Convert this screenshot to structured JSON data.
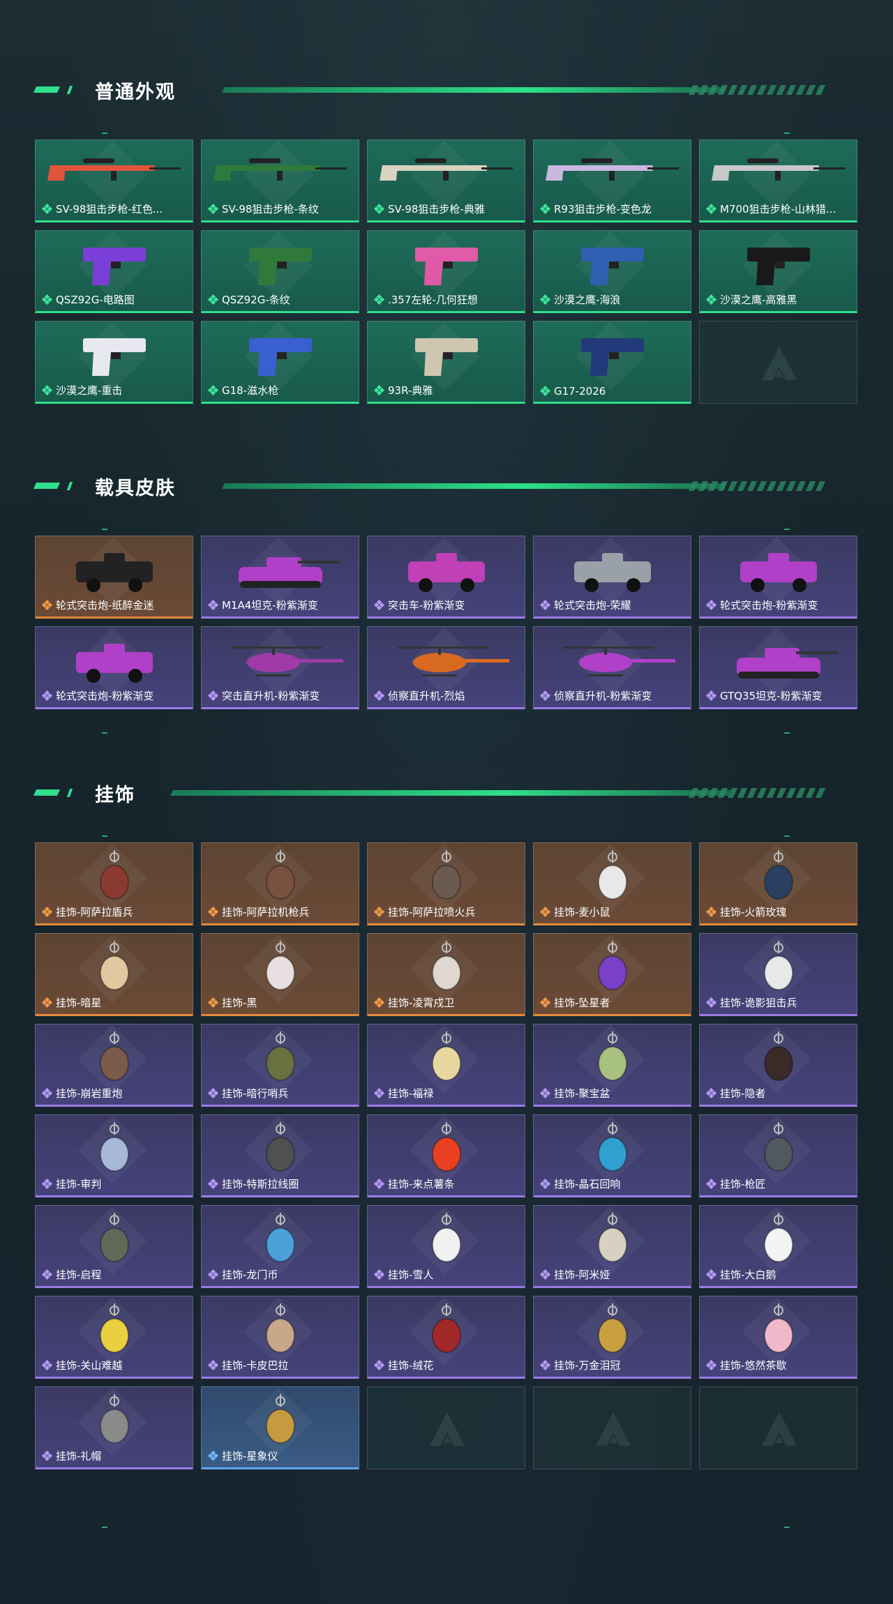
{
  "sections": {
    "weapons": {
      "title": "普通外观",
      "items": [
        {
          "label": "SV-98狙击步枪-红色...",
          "rarity": "green",
          "icon": "sniper-rifle-icon",
          "color": "#e0553b"
        },
        {
          "label": "SV-98狙击步枪-条纹",
          "rarity": "green",
          "icon": "sniper-rifle-icon",
          "color": "#2f7a3a"
        },
        {
          "label": "SV-98狙击步枪-典雅",
          "rarity": "green",
          "icon": "sniper-rifle-icon",
          "color": "#d8d2c0"
        },
        {
          "label": "R93狙击步枪-变色龙",
          "rarity": "green",
          "icon": "sniper-rifle-icon",
          "color": "#c9b8e0"
        },
        {
          "label": "M700狙击步枪-山林猎...",
          "rarity": "green",
          "icon": "sniper-rifle-icon",
          "color": "#c8c8c8"
        },
        {
          "label": "QSZ92G-电路图",
          "rarity": "green",
          "icon": "pistol-icon",
          "color": "#7a3fd6"
        },
        {
          "label": "QSZ92G-条纹",
          "rarity": "green",
          "icon": "pistol-icon",
          "color": "#2f7a3a"
        },
        {
          "label": ".357左轮-几何狂想",
          "rarity": "green",
          "icon": "revolver-icon",
          "color": "#e05aa8"
        },
        {
          "label": "沙漠之鹰-海浪",
          "rarity": "green",
          "icon": "pistol-icon",
          "color": "#2f5fb0"
        },
        {
          "label": "沙漠之鹰-高雅黑",
          "rarity": "green",
          "icon": "pistol-icon",
          "color": "#1a1a1a"
        },
        {
          "label": "沙漠之鹰-重击",
          "rarity": "green",
          "icon": "pistol-icon",
          "color": "#e8e8f0"
        },
        {
          "label": "G18-滋水枪",
          "rarity": "green",
          "icon": "pistol-icon",
          "color": "#3a5fd0"
        },
        {
          "label": "93R-典雅",
          "rarity": "green",
          "icon": "pistol-icon",
          "color": "#cfc6b0"
        },
        {
          "label": "G17-2026",
          "rarity": "green",
          "icon": "pistol-icon",
          "color": "#223a7a"
        },
        {
          "label": "",
          "rarity": "empty",
          "icon": "empty-slot-logo-icon",
          "color": ""
        }
      ]
    },
    "vehicles": {
      "title": "载具皮肤",
      "items": [
        {
          "label": "轮式突击炮-纸醉金迷",
          "rarity": "orange",
          "icon": "armored-car-icon",
          "color": "#222222"
        },
        {
          "label": "M1A4坦克-粉紫渐变",
          "rarity": "purple",
          "icon": "tank-icon",
          "color": "#b040c8"
        },
        {
          "label": "突击车-粉紫渐变",
          "rarity": "purple",
          "icon": "assault-vehicle-icon",
          "color": "#c040b8"
        },
        {
          "label": "轮式突击炮-荣耀",
          "rarity": "purple",
          "icon": "armored-car-icon",
          "color": "#9aa0a8"
        },
        {
          "label": "轮式突击炮-粉紫渐变",
          "rarity": "purple",
          "icon": "armored-car-icon",
          "color": "#b040c8"
        },
        {
          "label": "轮式突击炮-粉紫渐变",
          "rarity": "purple",
          "icon": "armored-car-icon",
          "color": "#b040c8"
        },
        {
          "label": "突击直升机-粉紫渐变",
          "rarity": "purple",
          "icon": "attack-helicopter-icon",
          "color": "#a03aa8"
        },
        {
          "label": "侦察直升机-烈焰",
          "rarity": "purple",
          "icon": "scout-helicopter-icon",
          "color": "#d86a20"
        },
        {
          "label": "侦察直升机-粉紫渐变",
          "rarity": "purple",
          "icon": "scout-helicopter-icon",
          "color": "#b040c8"
        },
        {
          "label": "GTQ35坦克-粉紫渐变",
          "rarity": "purple",
          "icon": "tank-icon",
          "color": "#b040c8"
        }
      ]
    },
    "charms": {
      "title": "挂饰",
      "items": [
        {
          "label": "挂饰-阿萨拉盾兵",
          "rarity": "orange",
          "icon": "charm-figure-icon",
          "color": "#8a3a30"
        },
        {
          "label": "挂饰-阿萨拉机枪兵",
          "rarity": "orange",
          "icon": "charm-figure-icon",
          "color": "#7a5040"
        },
        {
          "label": "挂饰-阿萨拉喷火兵",
          "rarity": "orange",
          "icon": "charm-figure-icon",
          "color": "#6a5a50"
        },
        {
          "label": "挂饰-麦小鼠",
          "rarity": "orange",
          "icon": "charm-mouse-icon",
          "color": "#e8e8e8"
        },
        {
          "label": "挂饰-火箭玫瑰",
          "rarity": "orange",
          "icon": "charm-rocket-icon",
          "color": "#2a4060"
        },
        {
          "label": "挂饰-暗星",
          "rarity": "orange",
          "icon": "charm-feather-icon",
          "color": "#e0c8a0"
        },
        {
          "label": "挂饰-黑",
          "rarity": "orange",
          "icon": "charm-tag-icon",
          "color": "#e8e0e0"
        },
        {
          "label": "挂饰-凌霄戍卫",
          "rarity": "orange",
          "icon": "charm-figure-icon",
          "color": "#e0d8d0"
        },
        {
          "label": "挂饰-坠星者",
          "rarity": "orange",
          "icon": "charm-crystal-icon",
          "color": "#7a40c8"
        },
        {
          "label": "挂饰-诡影狙击兵",
          "rarity": "purple",
          "icon": "charm-skull-icon",
          "color": "#e8e8e8"
        },
        {
          "label": "挂饰-崩岩重炮",
          "rarity": "purple",
          "icon": "charm-figure-icon",
          "color": "#7a5a48"
        },
        {
          "label": "挂饰-暗行哨兵",
          "rarity": "purple",
          "icon": "charm-figure-icon",
          "color": "#6a7040"
        },
        {
          "label": "挂饰-福禄",
          "rarity": "purple",
          "icon": "charm-figure-icon",
          "color": "#e8d8a0"
        },
        {
          "label": "挂饰-聚宝盆",
          "rarity": "purple",
          "icon": "charm-bowl-icon",
          "color": "#a8c080"
        },
        {
          "label": "挂饰-隐者",
          "rarity": "purple",
          "icon": "charm-card-icon",
          "color": "#3a2a28"
        },
        {
          "label": "挂饰-审判",
          "rarity": "purple",
          "icon": "charm-card-icon",
          "color": "#a8b8d8"
        },
        {
          "label": "挂饰-特斯拉线圈",
          "rarity": "purple",
          "icon": "charm-coil-icon",
          "color": "#505050"
        },
        {
          "label": "挂饰-来点薯条",
          "rarity": "purple",
          "icon": "charm-fries-icon",
          "color": "#e84020"
        },
        {
          "label": "挂饰-晶石回响",
          "rarity": "purple",
          "icon": "charm-gem-icon",
          "color": "#30a0d0"
        },
        {
          "label": "挂饰-枪匠",
          "rarity": "purple",
          "icon": "charm-box-icon",
          "color": "#505860"
        },
        {
          "label": "挂饰-启程",
          "rarity": "purple",
          "icon": "charm-compass-icon",
          "color": "#606858"
        },
        {
          "label": "挂饰-龙门币",
          "rarity": "purple",
          "icon": "charm-tag-icon",
          "color": "#4aa0d8"
        },
        {
          "label": "挂饰-雪人",
          "rarity": "purple",
          "icon": "charm-snowman-icon",
          "color": "#f0f0f0"
        },
        {
          "label": "挂饰-阿米娅",
          "rarity": "purple",
          "icon": "charm-figure-icon",
          "color": "#d8d0c0"
        },
        {
          "label": "挂饰-大白鹅",
          "rarity": "purple",
          "icon": "charm-goose-icon",
          "color": "#f4f4f4"
        },
        {
          "label": "挂饰-关山难越",
          "rarity": "purple",
          "icon": "charm-cylinder-icon",
          "color": "#e8d040"
        },
        {
          "label": "挂饰-卡皮巴拉",
          "rarity": "purple",
          "icon": "charm-capybara-icon",
          "color": "#c8a888"
        },
        {
          "label": "挂饰-绒花",
          "rarity": "purple",
          "icon": "charm-flower-icon",
          "color": "#a02828"
        },
        {
          "label": "挂饰-万金泪冠",
          "rarity": "purple",
          "icon": "charm-burger-icon",
          "color": "#c8a040"
        },
        {
          "label": "挂饰-悠然茶歇",
          "rarity": "purple",
          "icon": "charm-cupcake-icon",
          "color": "#f0b8c8"
        },
        {
          "label": "挂饰-礼帽",
          "rarity": "purple",
          "icon": "charm-hat-icon",
          "color": "#8a8a8a"
        },
        {
          "label": "挂饰-星象仪",
          "rarity": "blue",
          "icon": "charm-astrolabe-icon",
          "color": "#c89a40"
        },
        {
          "label": "",
          "rarity": "empty",
          "icon": "empty-slot-logo-icon",
          "color": ""
        },
        {
          "label": "",
          "rarity": "empty",
          "icon": "empty-slot-logo-icon",
          "color": ""
        },
        {
          "label": "",
          "rarity": "empty",
          "icon": "empty-slot-logo-icon",
          "color": ""
        }
      ]
    }
  },
  "colors": {
    "accent": "#2fe08c",
    "green_card": "#1e6b58",
    "purple_card": "#3f3d6c",
    "orange_card": "#644836",
    "blue_card": "#34527a"
  }
}
